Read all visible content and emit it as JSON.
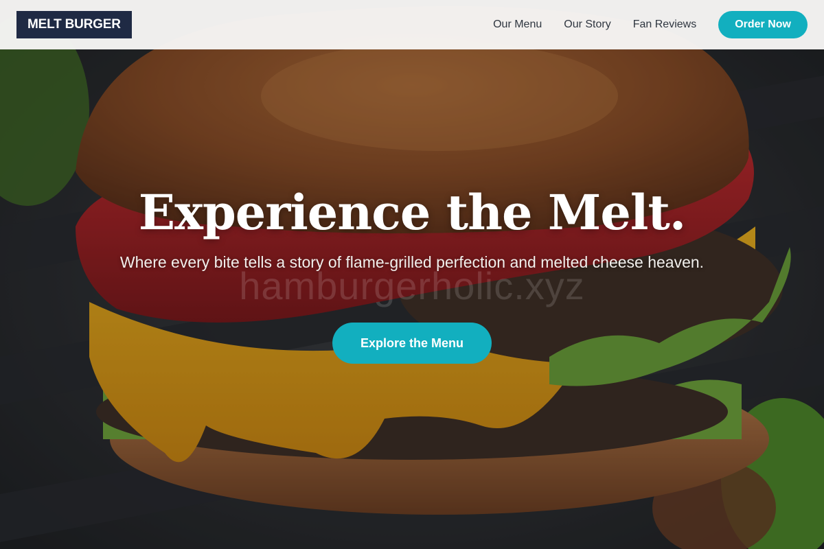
{
  "header": {
    "logo": "MELT BURGER",
    "nav": [
      {
        "label": "Our Menu"
      },
      {
        "label": "Our Story"
      },
      {
        "label": "Fan Reviews"
      }
    ],
    "order_label": "Order Now"
  },
  "hero": {
    "title": "Experience the Melt.",
    "subtitle": "Where every bite tells a story of flame-grilled perfection and melted cheese heaven.",
    "watermark": "hamburgerholic.xyz",
    "cta_label": "Explore the Menu",
    "background_image": "hamburger-photo"
  },
  "colors": {
    "accent": "#12afbf",
    "logo_background": "#1f2a44",
    "header_background": "#f8f7f6"
  }
}
